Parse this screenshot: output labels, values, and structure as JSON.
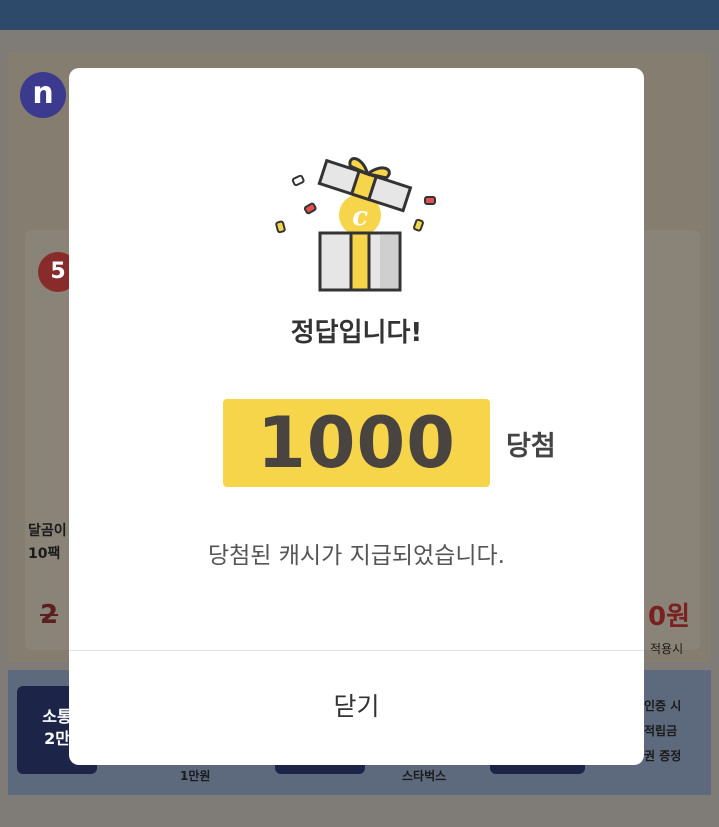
{
  "background": {
    "logo_letter": "n",
    "badge_text": "5",
    "product_line1": "달곰이",
    "product_line2": "10팩",
    "price_left": "2",
    "price_right": "0원",
    "price_right_note": "적용시",
    "bottom_left_line1": "소통",
    "bottom_left_line2": "2만",
    "bottom_caption_1": "1만원",
    "bottom_caption_2": "스타벅스",
    "bottom_right_line1": "인증 시",
    "bottom_right_line2": "적립금",
    "bottom_right_line3": "권 증정"
  },
  "modal": {
    "icon": "gift-box-cash-icon",
    "headline": "정답입니다!",
    "prize_amount": "1000",
    "prize_suffix": "당첨",
    "message": "당첨된 캐시가 지급되었습니다.",
    "close_label": "닫기"
  },
  "colors": {
    "prize_highlight": "#f7d54a",
    "overlay": "#837f7a",
    "modal_bg": "#ffffff"
  }
}
